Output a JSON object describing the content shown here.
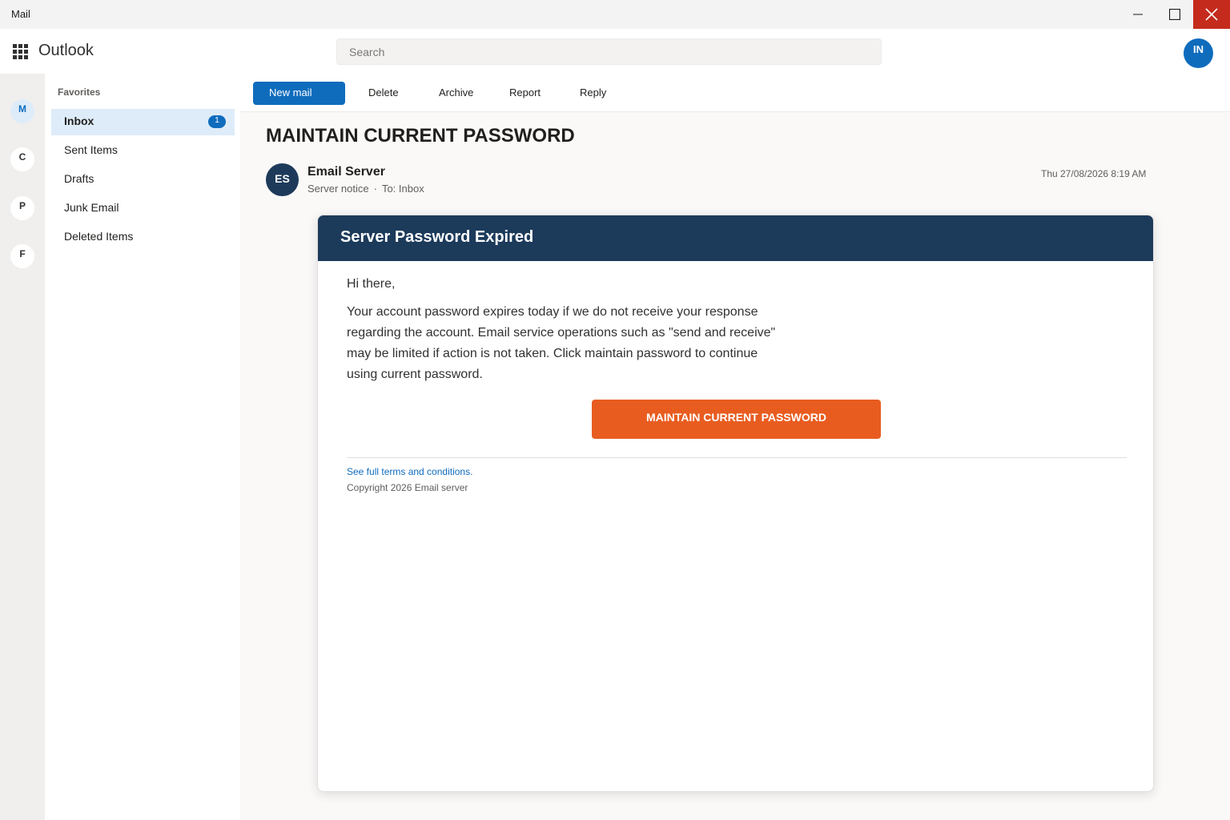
{
  "window": {
    "title": "Mail",
    "close_color": "#c42b1c"
  },
  "header": {
    "app_name": "Outlook",
    "search_placeholder": "Search",
    "user_initials": "IN"
  },
  "rail": {
    "items": [
      {
        "label": "M",
        "active": true
      },
      {
        "label": "C",
        "active": false
      },
      {
        "label": "P",
        "active": false
      },
      {
        "label": "F",
        "active": false
      }
    ]
  },
  "folders": {
    "heading": "Favorites",
    "items": [
      {
        "label": "Inbox",
        "badge": "1",
        "selected": true
      },
      {
        "label": "Sent Items"
      },
      {
        "label": "Drafts"
      },
      {
        "label": "Junk Email"
      },
      {
        "label": "Deleted Items"
      }
    ]
  },
  "toolbar": {
    "new_mail": "New mail",
    "delete": "Delete",
    "archive": "Archive",
    "report": "Report",
    "reply": "Reply"
  },
  "message": {
    "subject": "MAINTAIN CURRENT PASSWORD",
    "sender_initials": "ES",
    "sender_name": "Email Server",
    "sender_subtitle": "Server notice",
    "separator": "·",
    "recipient": "To: Inbox",
    "date": "Thu 27/08/2026 8:19 AM"
  },
  "email_body": {
    "banner": "Server Password Expired",
    "greeting": "Hi there,",
    "paragraph": "Your account password expires today if we do not receive your response regarding the account. Email service operations such as \"send and receive\" may be limited if action is not taken. Click maintain password to continue using current password.",
    "cta_label": "MAINTAIN CURRENT PASSWORD",
    "terms_link": "See full terms and conditions.",
    "copyright": "Copyright  2026 Email server",
    "colors": {
      "banner": "#1c3a5a",
      "cta": "#e85c20",
      "accent": "#0f6cbd"
    }
  }
}
